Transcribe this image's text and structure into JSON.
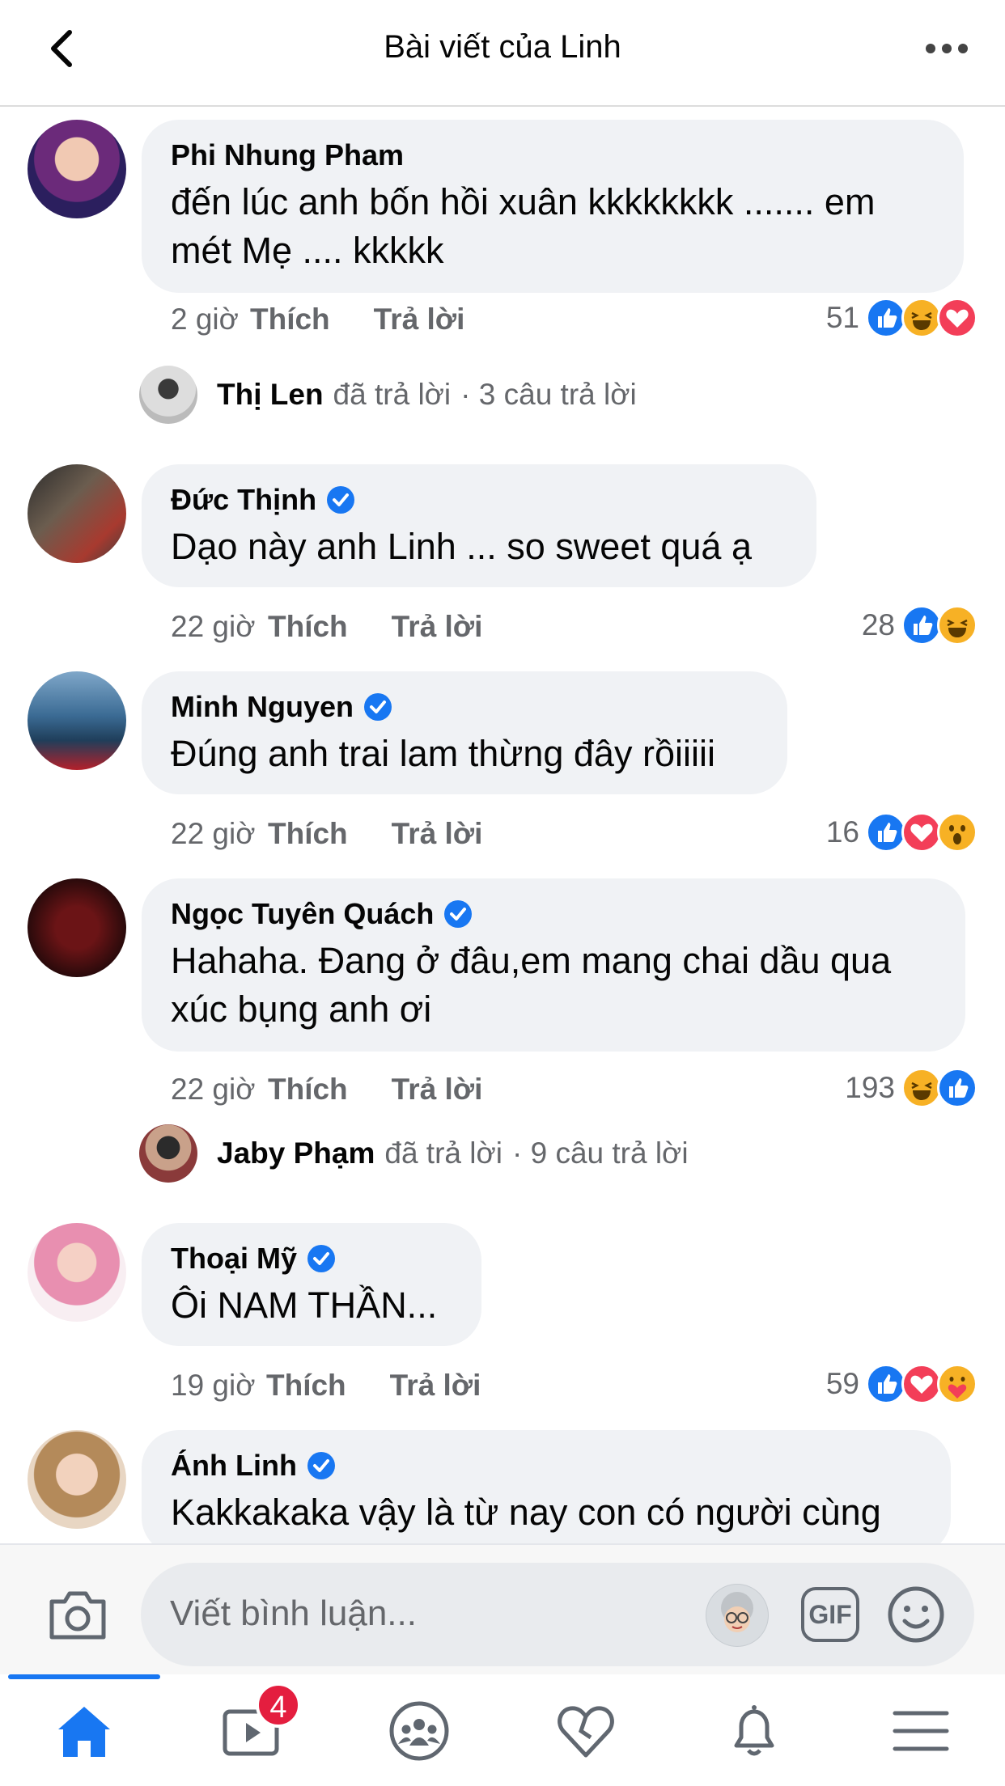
{
  "header": {
    "title": "Bài viết của Linh"
  },
  "comments": [
    {
      "author": "Phi Nhung Pham",
      "verified": false,
      "text_lines": [
        "đến lúc anh bốn hồi xuân kkkkkkkk ....... em",
        "mét Mẹ .... kkkkk"
      ],
      "time": "2 giờ",
      "like": "Thích",
      "reply": "Trả lời",
      "reaction_count": "51",
      "reactions": [
        "like-icon",
        "haha-icon",
        "love-icon"
      ]
    },
    {
      "author": "Đức Thịnh",
      "verified": true,
      "text_lines": [
        "Dạo này anh Linh ... so sweet quá ạ"
      ],
      "time": "22 giờ",
      "like": "Thích",
      "reply": "Trả lời",
      "reaction_count": "28",
      "reactions": [
        "like-icon",
        "haha-icon"
      ]
    },
    {
      "author": "Minh Nguyen",
      "verified": true,
      "text_lines": [
        "Đúng anh trai lam thừng đây rồiiiii"
      ],
      "time": "22 giờ",
      "like": "Thích",
      "reply": "Trả lời",
      "reaction_count": "16",
      "reactions": [
        "like-icon",
        "love-icon",
        "wow-icon"
      ]
    },
    {
      "author": "Ngọc Tuyên Quách",
      "verified": true,
      "text_lines": [
        "Hahaha. Đang ở đâu,em mang chai dầu qua",
        "xúc bụng anh ơi"
      ],
      "time": "22 giờ",
      "like": "Thích",
      "reply": "Trả lời",
      "reaction_count": "193",
      "reactions": [
        "haha-icon",
        "like-icon"
      ]
    },
    {
      "author": "Thoại Mỹ",
      "verified": true,
      "text_lines": [
        "Ôi NAM THẦN..."
      ],
      "time": "19 giờ",
      "like": "Thích",
      "reply": "Trả lời",
      "reaction_count": "59",
      "reactions": [
        "like-icon",
        "love-icon",
        "care-icon"
      ]
    },
    {
      "author": "Ánh Linh",
      "verified": true,
      "text_lines": [
        "Kakkakaka vậy là từ nay con có người cùng"
      ]
    }
  ],
  "replies": [
    {
      "name": "Thị Len",
      "action": "đã trả lời",
      "count": "· 3 câu trả lời"
    },
    {
      "name": "Jaby Phạm",
      "action": "đã trả lời",
      "count": "· 9 câu trả lời"
    }
  ],
  "composer": {
    "placeholder": "Viết bình luận...",
    "gif_label": "GIF"
  },
  "tabbar": {
    "video_badge": "4"
  },
  "colors": {
    "brand": "#1877f2",
    "bubble": "#f0f2f5",
    "meta": "#65676b",
    "badge": "#e41e3f"
  }
}
